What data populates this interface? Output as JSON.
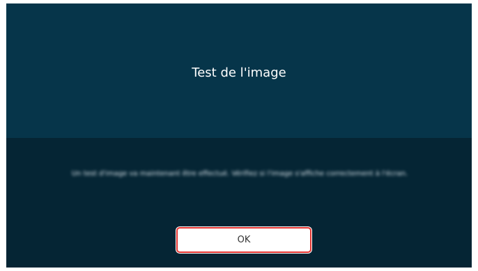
{
  "dialog": {
    "title": "Test de l'image",
    "message": "Un test d'image va maintenant être effectué. Vérifiez si l'image s'affiche correctement à l'écran.",
    "ok_label": "OK"
  },
  "colors": {
    "header_bg": "#06354a",
    "body_bg": "#052534",
    "focus_border": "#e2332f",
    "button_bg": "#ffffff"
  }
}
